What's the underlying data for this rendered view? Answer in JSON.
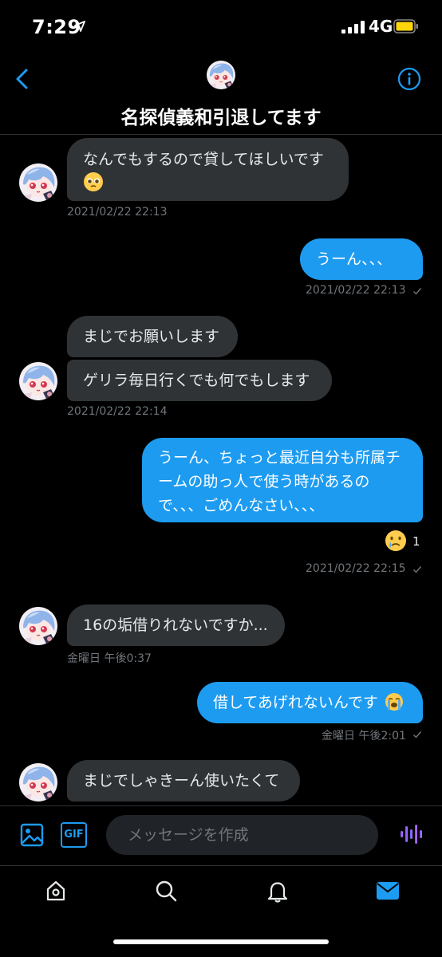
{
  "status_bar": {
    "time": "7:29",
    "network": "4G"
  },
  "header": {
    "title": "名探偵義和引退してます"
  },
  "messages": {
    "m1": "なんでもするので貸してほしいです",
    "t1": "2021/02/22 22:13",
    "m2": "うーん、、、",
    "t2": "2021/02/22 22:13",
    "m3": "まじでお願いします",
    "m4": "ゲリラ毎日行くでも何でもします",
    "t3": "2021/02/22 22:14",
    "m5_line1": "うーん、ちょっと最近自分も所属チ",
    "m5_line2": "ームの助っ人で使う時があるの",
    "m5_line3": "で、、、ごめんなさい、、、",
    "reaction_count": "1",
    "t4": "2021/02/22 22:15",
    "m6": "16の垢借りれないですか...",
    "t5": "金曜日 午後0:37",
    "m7": "借してあげれないんです",
    "t6": "金曜日 午後2:01",
    "m8": "まじでしゃきーん使いたくて"
  },
  "composer": {
    "placeholder": "メッセージを作成",
    "gif_label": "GIF"
  },
  "colors": {
    "accent": "#1d9bf0",
    "incoming_bubble": "#2f3336",
    "background": "#000000"
  },
  "icons": [
    "location-arrow-icon",
    "signal-icon",
    "battery-icon",
    "back-chevron-icon",
    "info-icon",
    "image-icon",
    "gif-icon",
    "voice-icon",
    "home-icon",
    "search-icon",
    "bell-icon",
    "mail-icon",
    "check-icon",
    "pleading-face-emoji",
    "crying-face-emoji",
    "loudly-crying-face-emoji"
  ]
}
